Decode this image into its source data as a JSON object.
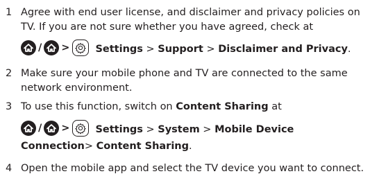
{
  "steps": [
    {
      "number": "1",
      "text": "Agree with end user license, and disclaimer and privacy policies on TV. If you are not sure whether you have agreed, check at",
      "path": {
        "icons": [
          "home-icon",
          "home-icon",
          "gear-icon"
        ],
        "slash": "/",
        "arrow": ">",
        "parts": [
          "Settings",
          ">",
          "Support",
          ">",
          "Disclaimer and Privacy",
          "."
        ]
      }
    },
    {
      "number": "2",
      "text": "Make sure your mobile phone and TV are connected to the same network environment."
    },
    {
      "number": "3",
      "text_prefix": "To use this function, switch on ",
      "text_bold": "Content Sharing",
      "text_suffix": " at",
      "path": {
        "icons": [
          "home-icon",
          "home-icon",
          "gear-icon"
        ],
        "slash": "/",
        "arrow": ">",
        "line1": [
          "Settings",
          ">",
          "System",
          ">",
          "Mobile Device"
        ],
        "line2": [
          "Connection",
          ">",
          "Content Sharing",
          "."
        ]
      }
    },
    {
      "number": "4",
      "text": "Open the mobile app and select the TV device you want to connect."
    }
  ]
}
